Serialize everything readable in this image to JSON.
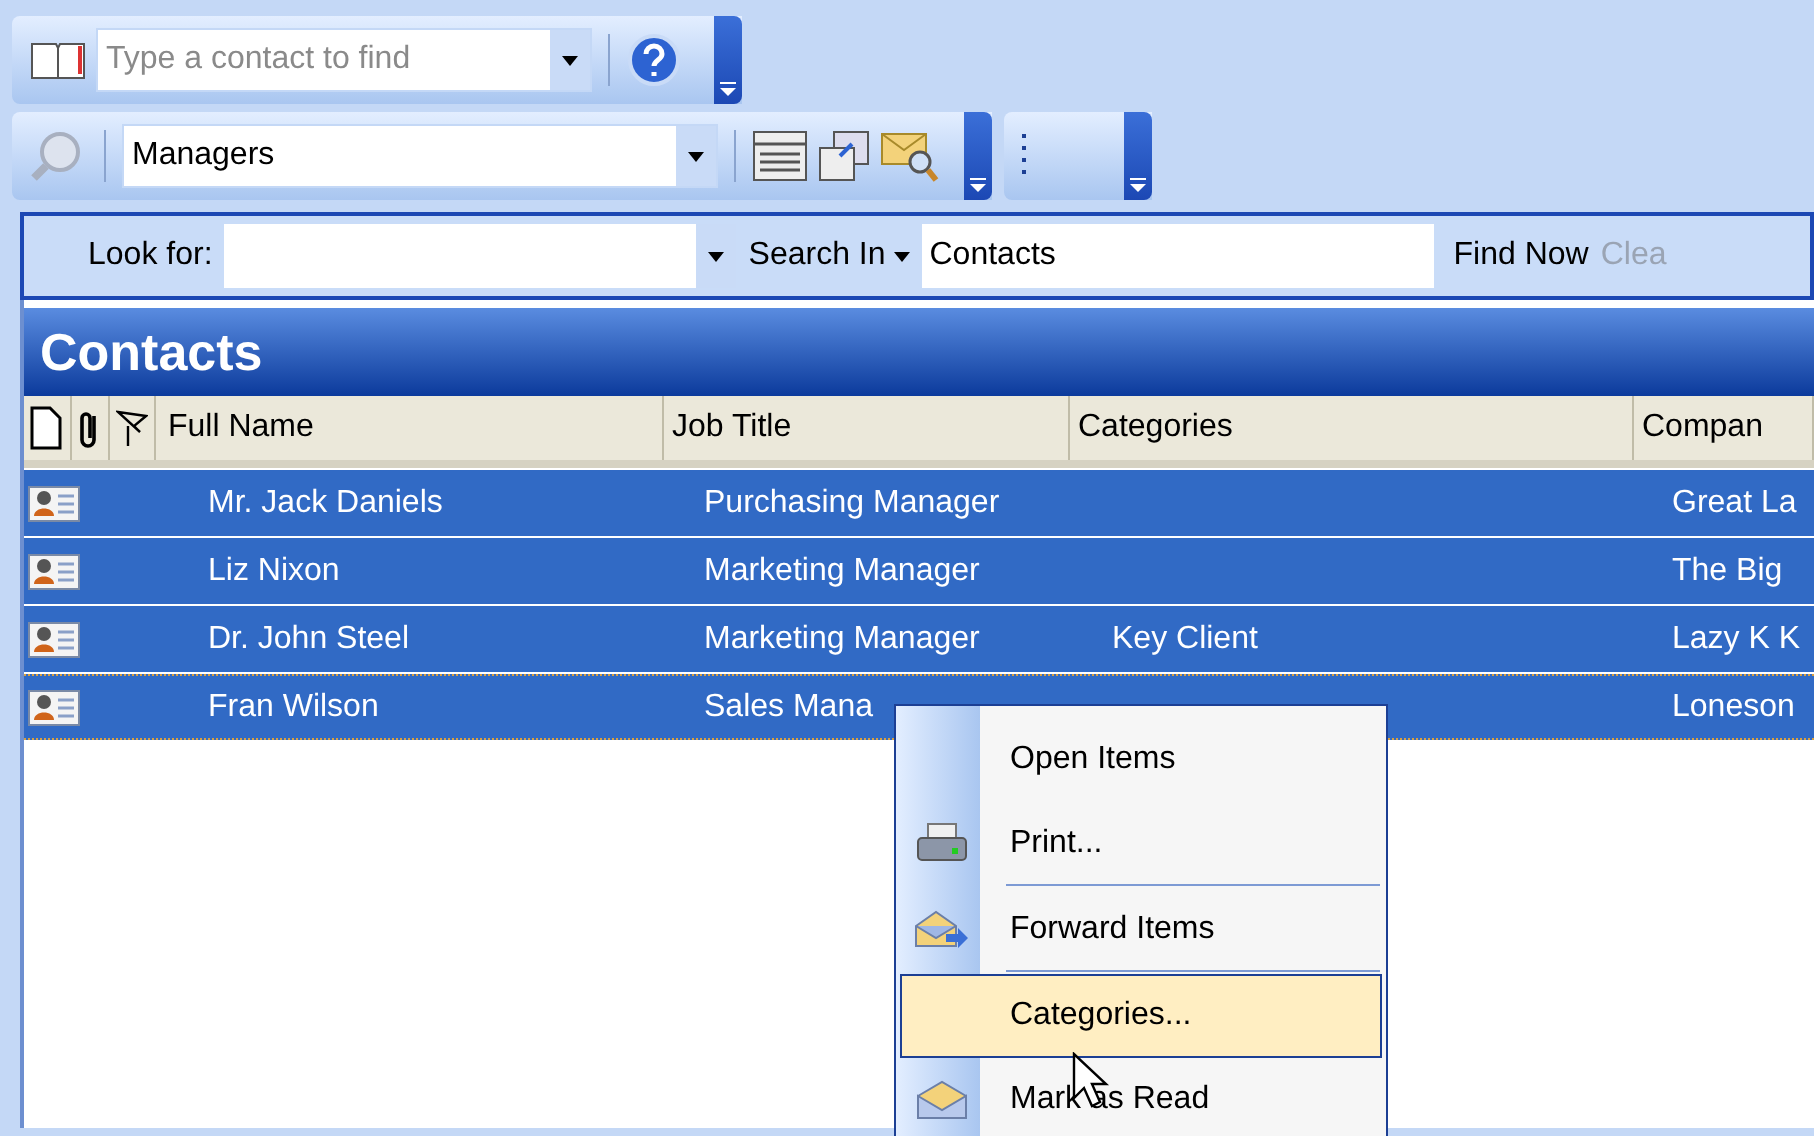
{
  "find_bar": {
    "placeholder": "Type a contact to find"
  },
  "view_bar": {
    "view": "Managers"
  },
  "search_bar": {
    "look_for_label": "Look for:",
    "search_in": "Search In",
    "scope": "Contacts",
    "find_now": "Find Now",
    "clear": "Clea"
  },
  "pane_title": "Contacts",
  "columns": [
    "Full Name",
    "Job Title",
    "Categories",
    "Compan"
  ],
  "rows": [
    {
      "full_name": "Mr. Jack Daniels",
      "job_title": "Purchasing Manager",
      "categories": "",
      "company": "Great La",
      "selected": true,
      "focused": false
    },
    {
      "full_name": "Liz Nixon",
      "job_title": "Marketing Manager",
      "categories": "",
      "company": "The Big",
      "selected": true,
      "focused": false
    },
    {
      "full_name": "Dr. John Steel",
      "job_title": "Marketing Manager",
      "categories": "Key Client",
      "company": "Lazy K K",
      "selected": true,
      "focused": false
    },
    {
      "full_name": "Fran Wilson",
      "job_title": "Sales Mana",
      "categories": "",
      "company": "Loneson",
      "selected": true,
      "focused": true
    }
  ],
  "context_menu": [
    {
      "label": "Open Items",
      "kind": "plain",
      "selected": false,
      "separator_after": false
    },
    {
      "label": "Print...",
      "kind": "print",
      "selected": false,
      "separator_after": true
    },
    {
      "label": "Forward Items",
      "kind": "forward",
      "selected": false,
      "separator_after": true
    },
    {
      "label": "Categories...",
      "kind": "plain",
      "selected": true,
      "separator_after": false
    },
    {
      "label": "Mark as Read",
      "kind": "read",
      "selected": false,
      "separator_after": false
    }
  ]
}
